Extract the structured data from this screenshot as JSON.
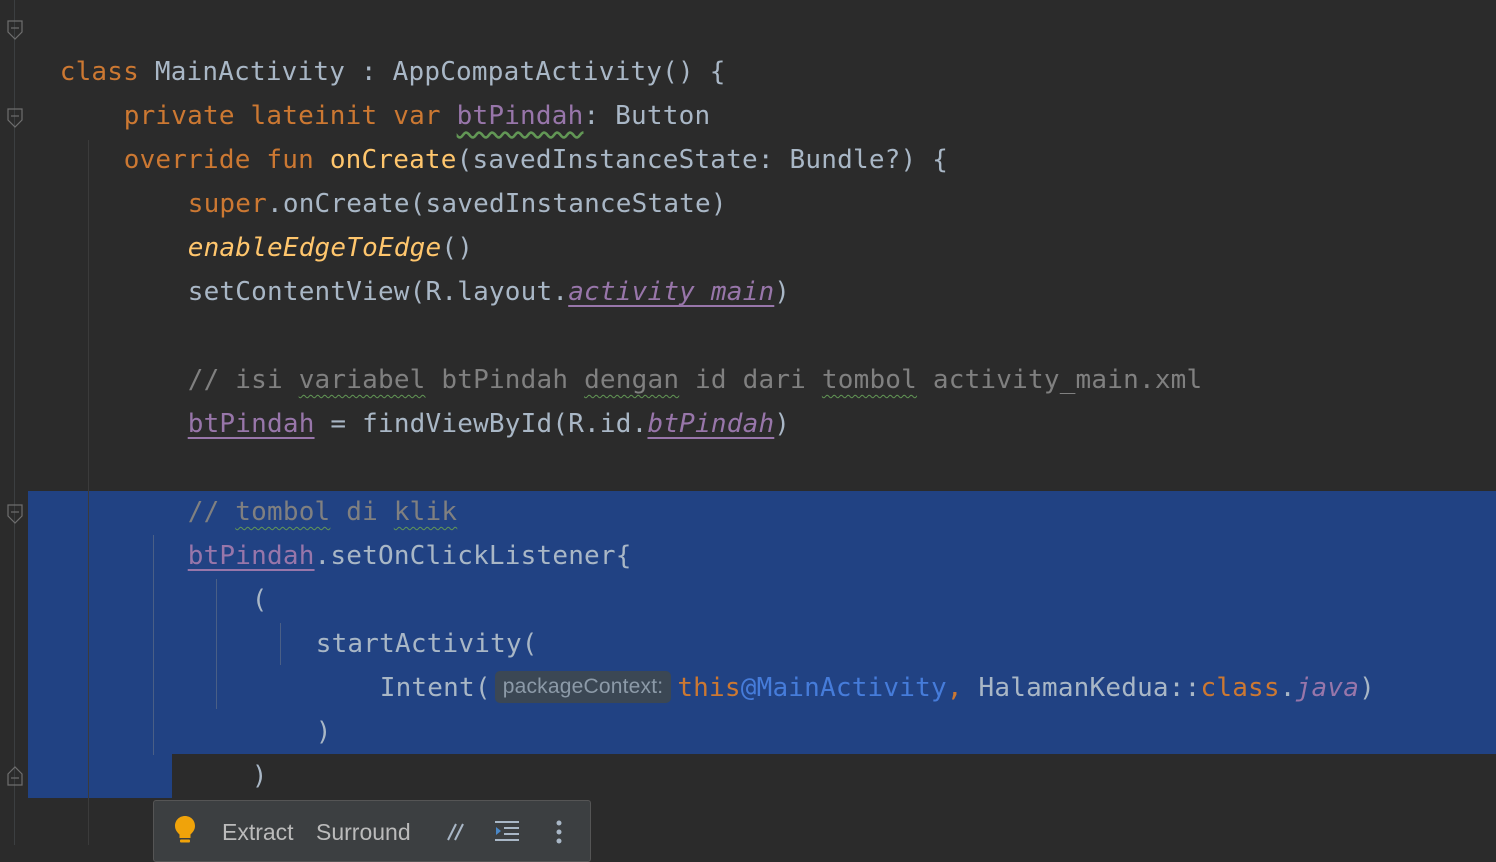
{
  "editor": {
    "lines": [
      {
        "t1": "class ",
        "t2": "MainActivity : AppCompatActivity() {"
      },
      {
        "kw": "private lateinit var ",
        "prop": "btPindah",
        "rest": ": Button"
      },
      {
        "kw": "override fun ",
        "fn": "onCreate",
        "rest": "(savedInstanceState: Bundle?) {"
      },
      {
        "kw": "super",
        "rest": ".onCreate(savedInstanceState)"
      },
      {
        "fn": "enableEdgeToEdge",
        "rest": "()"
      },
      {
        "pre": "setContentView(R.layout.",
        "prop": "activity_main",
        "rest": ")"
      },
      {
        "c1": "// isi ",
        "c2": "variabel",
        "c3": " btPindah ",
        "c4": "dengan",
        "c5": " id dari ",
        "c6": "tombol",
        "c7": " activity_main.xml"
      },
      {
        "prop": "btPindah",
        "pre": " = findViewById(R.id.",
        "prop2": "btPindah",
        "rest": ")"
      },
      {
        "c1": "// ",
        "c2": "tombol",
        "c3": " di ",
        "c4": "klik"
      },
      {
        "prop": "btPindah",
        "rest": ".setOnClickListener{"
      },
      {
        "rest": "("
      },
      {
        "rest": "startActivity("
      },
      {
        "pre": "Intent(",
        "hint": "packageContext:",
        "this": "this",
        "label": "@MainActivity",
        "comma": ", ",
        "rest": "HalamanKedua::",
        "kw": "class",
        "dot": ".",
        "java": "java",
        "close": ")"
      },
      {
        "rest": ")"
      },
      {
        "rest": ")"
      },
      {
        "rest": "}"
      }
    ]
  },
  "toolbar": {
    "extract_label": "Extract",
    "surround_label": "Surround",
    "bulb_icon": "lightbulb-icon",
    "comment_icon": "comment-icon",
    "format_icon": "reformat-icon",
    "more_icon": "more-vertical-icon"
  },
  "colors": {
    "background": "#2b2b2b",
    "selection": "#214283",
    "keyword": "#cc7832",
    "function": "#ffc66d",
    "property": "#9876aa",
    "comment": "#808080",
    "text": "#a9b7c6"
  }
}
